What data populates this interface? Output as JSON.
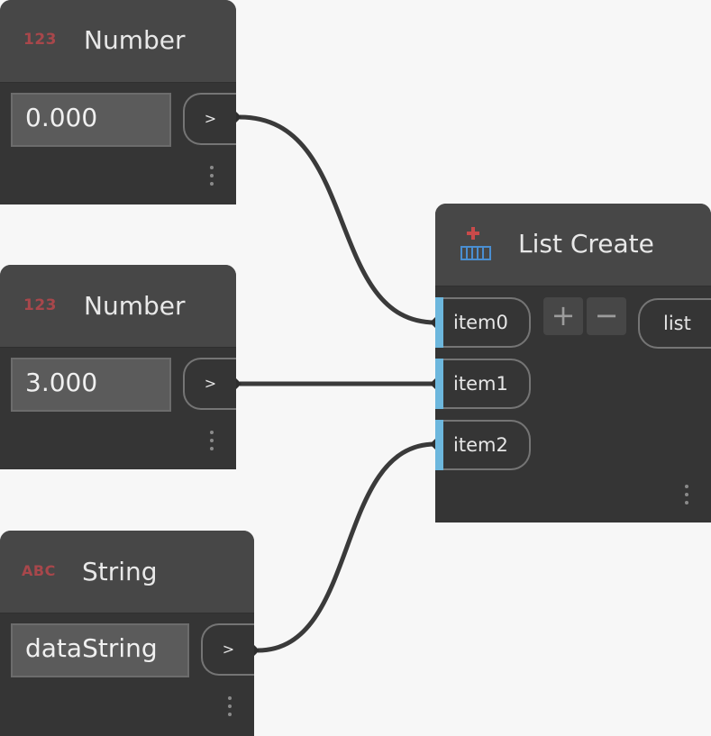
{
  "nodes": {
    "number1": {
      "icon_text": "123",
      "title": "Number",
      "value": "0.000",
      "output_label": ">"
    },
    "number2": {
      "icon_text": "123",
      "title": "Number",
      "value": "3.000",
      "output_label": ">"
    },
    "string1": {
      "icon_text": "ABC",
      "title": "String",
      "value": "dataString",
      "output_label": ">"
    },
    "list_create": {
      "icon": "list-create-icon",
      "title": "List Create",
      "inputs": [
        {
          "label": "item0"
        },
        {
          "label": "item1"
        },
        {
          "label": "item2"
        }
      ],
      "add_label": "+",
      "remove_label": "−",
      "output_label": "list"
    }
  },
  "colors": {
    "canvas": "#f7f7f7",
    "node_body": "#353535",
    "node_header": "#474747",
    "port_accent": "#6db7dd",
    "wire": "#3a3a3a",
    "type_icon": "#a8474b"
  }
}
